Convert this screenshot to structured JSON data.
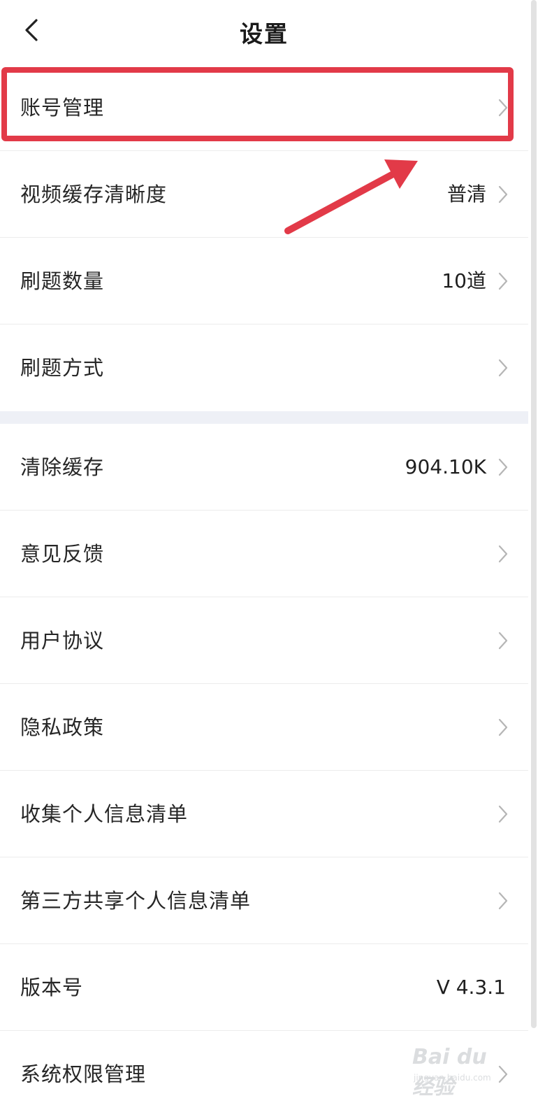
{
  "header": {
    "title": "设置"
  },
  "settings": {
    "group1": [
      {
        "label": "账号管理",
        "value": ""
      },
      {
        "label": "视频缓存清晰度",
        "value": "普清"
      },
      {
        "label": "刷题数量",
        "value": "10道"
      },
      {
        "label": "刷题方式",
        "value": ""
      }
    ],
    "group2": [
      {
        "label": "清除缓存",
        "value": "904.10K"
      },
      {
        "label": "意见反馈",
        "value": ""
      },
      {
        "label": "用户协议",
        "value": ""
      },
      {
        "label": "隐私政策",
        "value": ""
      },
      {
        "label": "收集个人信息清单",
        "value": ""
      },
      {
        "label": "第三方共享个人信息清单",
        "value": ""
      },
      {
        "label": "版本号",
        "value": "V 4.3.1"
      },
      {
        "label": "系统权限管理",
        "value": ""
      }
    ]
  },
  "annotation": {
    "highlight_color": "#e23a48"
  },
  "watermark": {
    "text": "Bai du 经验",
    "sub": "jingyan.baidu.com"
  },
  "icons": {
    "back": "chevron-left-icon",
    "row_arrow": "chevron-right-icon"
  }
}
